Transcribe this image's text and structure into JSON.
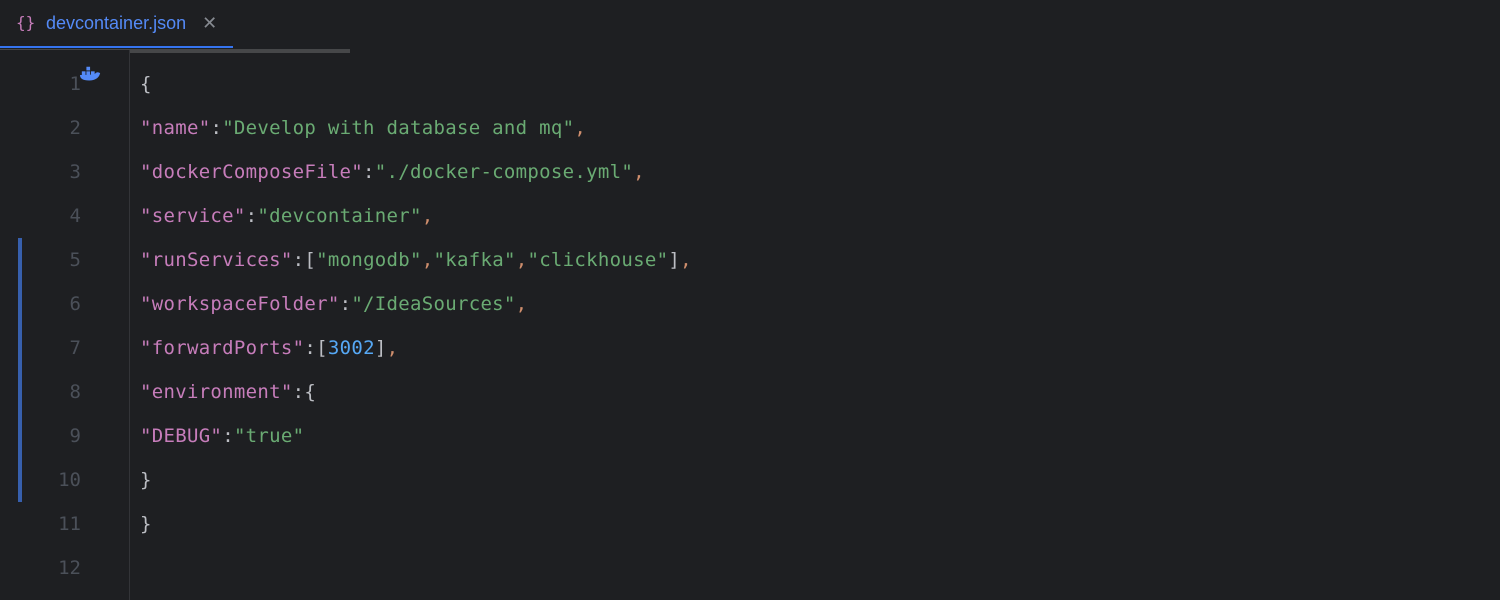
{
  "tab": {
    "title": "devcontainer.json"
  },
  "gutter": {
    "lines": [
      "1",
      "2",
      "3",
      "4",
      "5",
      "6",
      "7",
      "8",
      "9",
      "10",
      "11",
      "12"
    ]
  },
  "code": {
    "l1": "{",
    "name_key": "\"name\"",
    "name_val": "\"Develop with database and mq\"",
    "dcf_key": "\"dockerComposeFile\"",
    "dcf_val": "\"./docker-compose.yml\"",
    "svc_key": "\"service\"",
    "svc_val": "\"devcontainer\"",
    "rs_key": "\"runServices\"",
    "rs_v1": "\"mongodb\"",
    "rs_v2": "\"kafka\"",
    "rs_v3": "\"clickhouse\"",
    "wf_key": "\"workspaceFolder\"",
    "wf_val": "\"/IdeaSources\"",
    "fp_key": "\"forwardPorts\"",
    "fp_val": "3002",
    "env_key": "\"environment\"",
    "dbg_key": "\"DEBUG\"",
    "dbg_val": "\"true\"",
    "open_br": "[",
    "close_br": "]",
    "open_cb": "{",
    "close_cb": "}",
    "colon": ":",
    "comma": ","
  }
}
